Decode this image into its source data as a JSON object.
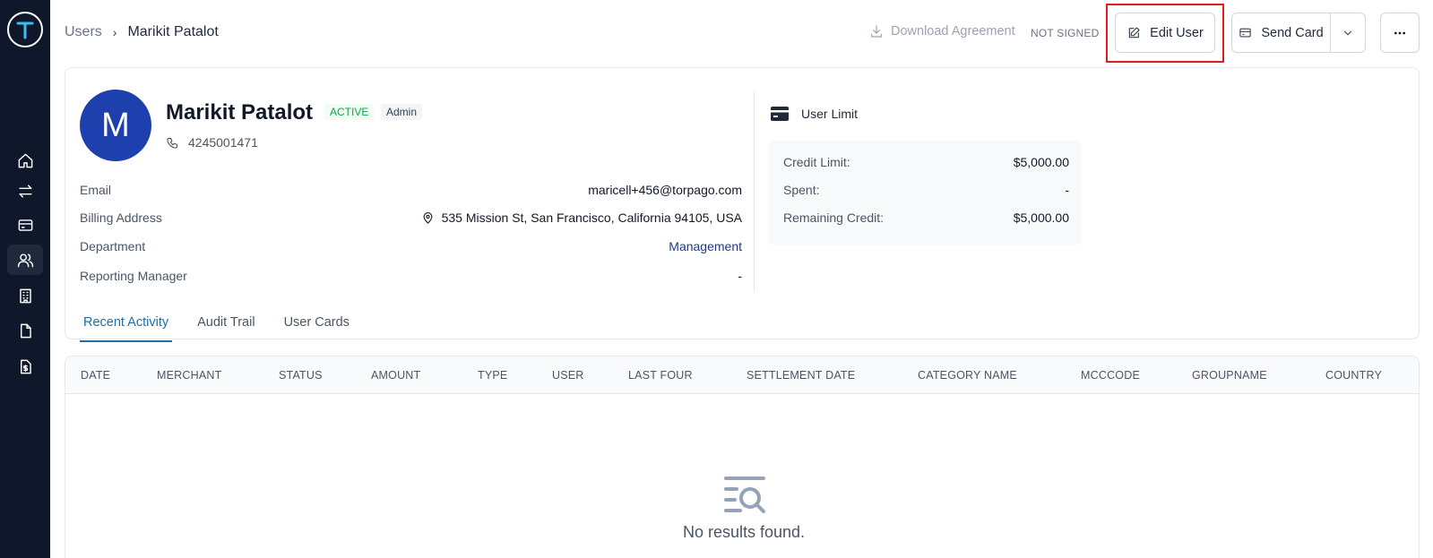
{
  "breadcrumb": {
    "parent": "Users",
    "separator": "›",
    "current": "Marikit Patalot"
  },
  "header": {
    "download_label": "Download Agreement",
    "agreement_status": "NOT SIGNED",
    "edit_label": "Edit User",
    "send_card_label": "Send Card"
  },
  "profile": {
    "initial": "M",
    "name": "Marikit Patalot",
    "status": "ACTIVE",
    "role": "Admin",
    "phone": "4245001471",
    "fields": [
      {
        "label": "Email",
        "value": "maricell+456@torpago.com"
      },
      {
        "label": "Billing Address",
        "value": "535 Mission St, San Francisco, California 94105, USA"
      },
      {
        "label": "Department",
        "value": "Management"
      },
      {
        "label": "Reporting Manager",
        "value": "-"
      }
    ]
  },
  "limit": {
    "title": "User Limit",
    "rows": [
      {
        "label": "Credit Limit:",
        "value": "$5,000.00"
      },
      {
        "label": "Spent:",
        "value": "-"
      },
      {
        "label": "Remaining Credit:",
        "value": "$5,000.00"
      }
    ]
  },
  "tabs": [
    {
      "label": "Recent Activity",
      "active": true
    },
    {
      "label": "Audit Trail",
      "active": false
    },
    {
      "label": "User Cards",
      "active": false
    }
  ],
  "table": {
    "columns": [
      "DATE",
      "MERCHANT",
      "STATUS",
      "AMOUNT",
      "TYPE",
      "USER",
      "LAST FOUR",
      "SETTLEMENT DATE",
      "CATEGORY NAME",
      "MCCCODE",
      "GROUPNAME",
      "COUNTRY"
    ],
    "empty_message": "No results found."
  },
  "sidebar": {
    "items": [
      {
        "icon": "home-icon"
      },
      {
        "icon": "transfer-icon"
      },
      {
        "icon": "card-icon"
      },
      {
        "icon": "users-icon",
        "active": true
      },
      {
        "icon": "building-icon"
      },
      {
        "icon": "document-icon"
      },
      {
        "icon": "invoice-icon"
      }
    ]
  },
  "colors": {
    "sidebar": "#0f172a",
    "accent": "#1d6fa8",
    "avatar": "#1e40af",
    "highlight": "#e11d1d",
    "active_badge": "#16a34a"
  }
}
